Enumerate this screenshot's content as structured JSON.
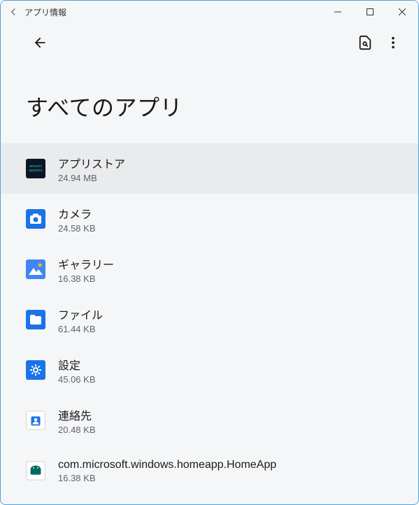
{
  "window": {
    "title": "アプリ情報"
  },
  "page": {
    "title": "すべてのアプリ"
  },
  "apps": [
    {
      "name": "アプリストア",
      "size": "24.94 MB",
      "icon": "appstore",
      "selected": true
    },
    {
      "name": "カメラ",
      "size": "24.58 KB",
      "icon": "camera",
      "selected": false
    },
    {
      "name": "ギャラリー",
      "size": "16.38 KB",
      "icon": "gallery",
      "selected": false
    },
    {
      "name": "ファイル",
      "size": "61.44 KB",
      "icon": "file",
      "selected": false
    },
    {
      "name": "設定",
      "size": "45.06 KB",
      "icon": "settings",
      "selected": false
    },
    {
      "name": "連絡先",
      "size": "20.48 KB",
      "icon": "contacts",
      "selected": false
    },
    {
      "name": "com.microsoft.windows.homeapp.HomeApp",
      "size": "16.38 KB",
      "icon": "android",
      "selected": false
    }
  ]
}
